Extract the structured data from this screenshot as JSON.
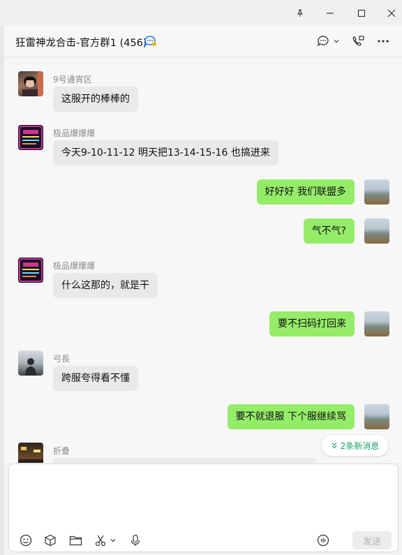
{
  "window": {
    "leaked_text": "……",
    "controls": [
      "pin-icon",
      "minimize-icon",
      "maximize-icon",
      "close-icon"
    ]
  },
  "header": {
    "title": "狂雷神龙合击-官方群1 (456)",
    "icons": [
      "group-badge-icon",
      "chat-bubble-icon",
      "chevron-down-icon",
      "video-call-icon",
      "more-icon"
    ]
  },
  "messages": [
    {
      "sender": "9号通宵区",
      "text": "这服开的棒棒的",
      "direction": "in",
      "avatar": "woman-photo"
    },
    {
      "sender": "极品爆爆爆",
      "text": "今天9-10-11-12  明天把13-14-15-16 也搞进来",
      "direction": "in",
      "avatar": "neon-sign"
    },
    {
      "sender": "",
      "text": "好好好 我们联盟多",
      "direction": "out",
      "avatar": "landscape"
    },
    {
      "sender": "",
      "text": "气不气?",
      "direction": "out",
      "avatar": "landscape"
    },
    {
      "sender": "极品爆爆爆",
      "text": "什么这那的，就是干",
      "direction": "in",
      "avatar": "neon-sign"
    },
    {
      "sender": "",
      "text": "要不扫码打回来",
      "direction": "out",
      "avatar": "landscape"
    },
    {
      "sender": "弓長",
      "text": "跨服夸得看不懂",
      "direction": "in",
      "avatar": "person-silhouette"
    },
    {
      "sender": "",
      "text": "要不就退服 下个服继续骂",
      "direction": "out",
      "avatar": "landscape"
    },
    {
      "sender": "折叠",
      "text": "",
      "direction": "in",
      "avatar": "night-street"
    }
  ],
  "new_messages": {
    "label": "2条新消息",
    "icon": "double-chevron-down-icon"
  },
  "composer": {
    "placeholder": "",
    "send_label": "发送",
    "tools": [
      "emoji-icon",
      "sticker-icon",
      "folder-icon",
      "scissors-icon",
      "chevron-down-icon",
      "microphone-icon",
      "voice-input-icon"
    ]
  },
  "colors": {
    "out_bubble": "#95ec69",
    "in_bubble": "#e9e9e9",
    "new_msg_text": "#19a15f"
  }
}
